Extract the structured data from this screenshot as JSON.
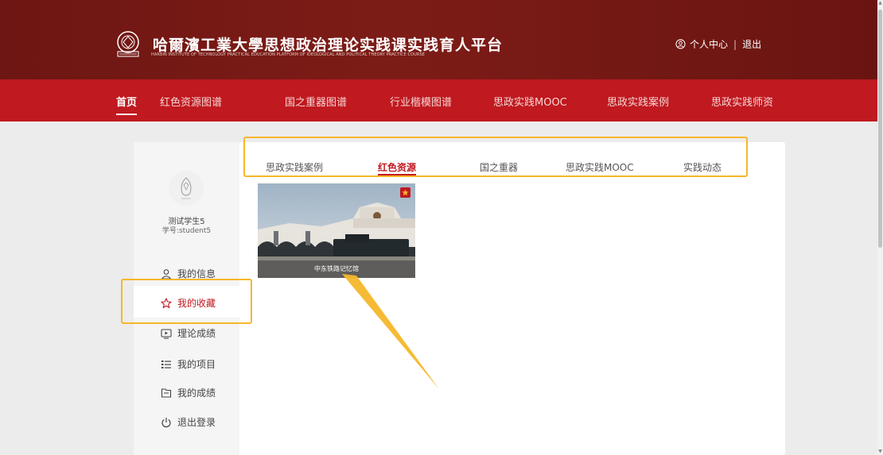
{
  "header": {
    "title": "哈爾濱工業大學思想政治理论实践课实践育人平台",
    "subtitle": "HARBIN INSTITUTE OF TECHNOLOGY PRACTICAL EDUCATION PLATFORM OF IDEOLOGICAL AND POLITICAL THEORY PRACTICE COURSE",
    "user_center": "个人中心",
    "separator": "|",
    "logout": "退出"
  },
  "nav": {
    "items": [
      {
        "label": "首页",
        "active": true
      },
      {
        "label": "红色资源图谱"
      },
      {
        "label": "国之重器图谱"
      },
      {
        "label": "行业楷模图谱"
      },
      {
        "label": "思政实践MOOC"
      },
      {
        "label": "思政实践案例"
      },
      {
        "label": "思政实践师资"
      }
    ]
  },
  "profile": {
    "name": "测试学生5",
    "student_id": "学号:student5"
  },
  "sidebar": {
    "items": [
      {
        "label": "我的信息",
        "icon": "user-icon"
      },
      {
        "label": "我的收藏",
        "icon": "star-icon",
        "active": true
      },
      {
        "label": "理论成绩",
        "icon": "play-box-icon"
      },
      {
        "label": "我的项目",
        "icon": "list-icon"
      },
      {
        "label": "我的成绩",
        "icon": "file-icon"
      },
      {
        "label": "退出登录",
        "icon": "power-icon"
      }
    ]
  },
  "tabs": [
    {
      "label": "思政实践案例"
    },
    {
      "label": "红色资源",
      "active": true
    },
    {
      "label": "国之重器"
    },
    {
      "label": "思政实践MOOC"
    },
    {
      "label": "实践动态"
    }
  ],
  "cards": [
    {
      "caption": "中东铁路记忆馆",
      "favorited": true
    }
  ],
  "colors": {
    "header_bg": "#6e1613",
    "nav_bg": "#c01920",
    "accent": "#c01920",
    "highlight": "#f5b72a"
  }
}
